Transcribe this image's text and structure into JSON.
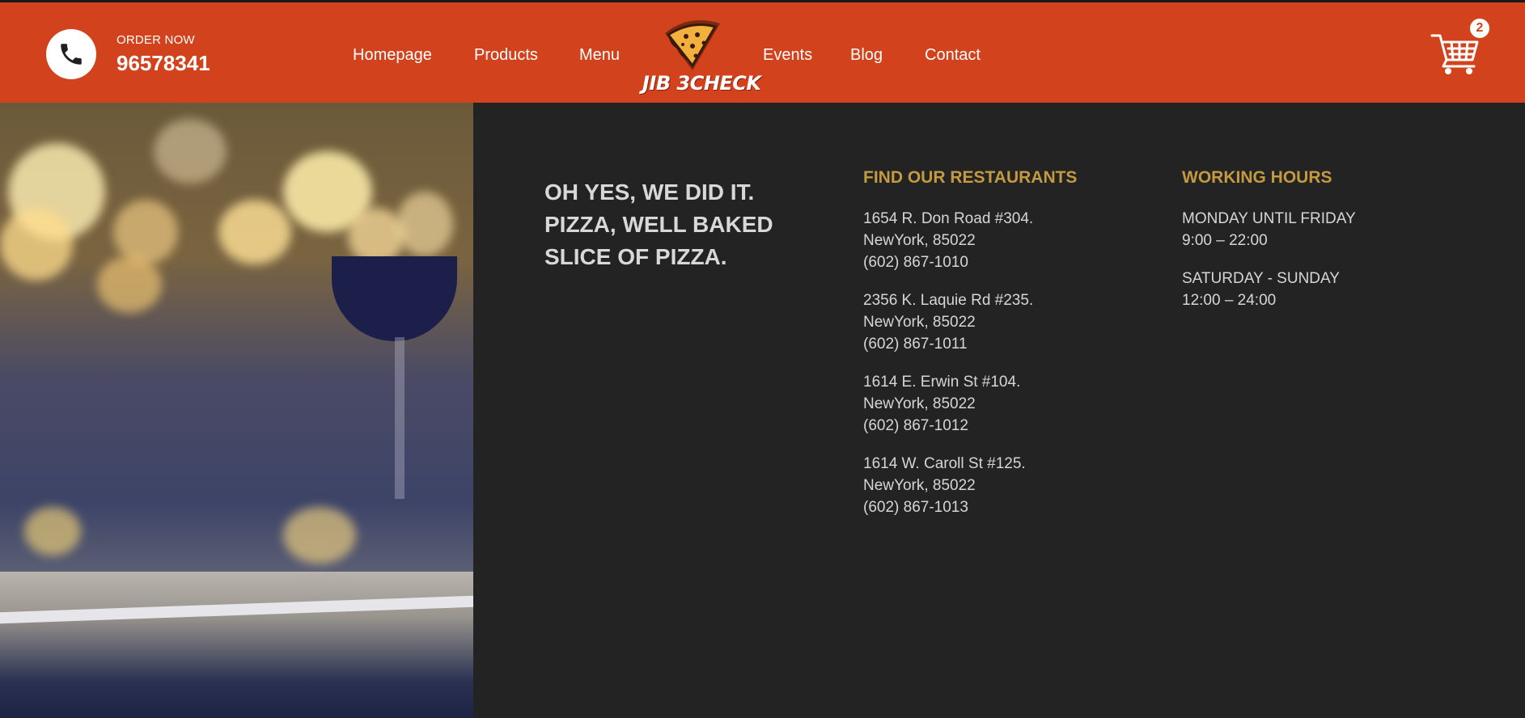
{
  "header": {
    "order_label": "ORDER NOW",
    "order_number": "96578341",
    "nav": [
      "Homepage",
      "Products",
      "Menu",
      "Events",
      "Blog",
      "Contact"
    ],
    "logo_text": "JIB 3CHECK",
    "cart_count": "2",
    "icons": [
      "phone-icon",
      "pizza-slice-logo",
      "shopping-cart-icon"
    ]
  },
  "colors": {
    "header_bg": "#d2421d",
    "body_bg": "#232323",
    "accent_gold": "#c39a3f"
  },
  "main": {
    "heading_lines": [
      "OH YES, WE DID IT.",
      "PIZZA, WELL BAKED",
      "SLICE OF PIZZA."
    ],
    "restaurants_title": "FIND OUR RESTAURANTS",
    "restaurants": [
      {
        "street": "1654 R. Don Road #304.",
        "city": "NewYork, 85022",
        "phone": "(602) 867-1010"
      },
      {
        "street": "2356 K. Laquie Rd #235.",
        "city": "NewYork, 85022",
        "phone": "(602) 867-1011"
      },
      {
        "street": "1614 E. Erwin St #104.",
        "city": "NewYork, 85022",
        "phone": "(602) 867-1012"
      },
      {
        "street": "1614 W. Caroll St #125.",
        "city": "NewYork, 85022",
        "phone": "(602) 867-1013"
      }
    ],
    "hours_title": "WORKING HOURS",
    "hours": [
      {
        "days": "MONDAY UNTIL FRIDAY",
        "time": "9:00 – 22:00"
      },
      {
        "days": "SATURDAY - SUNDAY",
        "time": "12:00 – 24:00"
      }
    ]
  }
}
